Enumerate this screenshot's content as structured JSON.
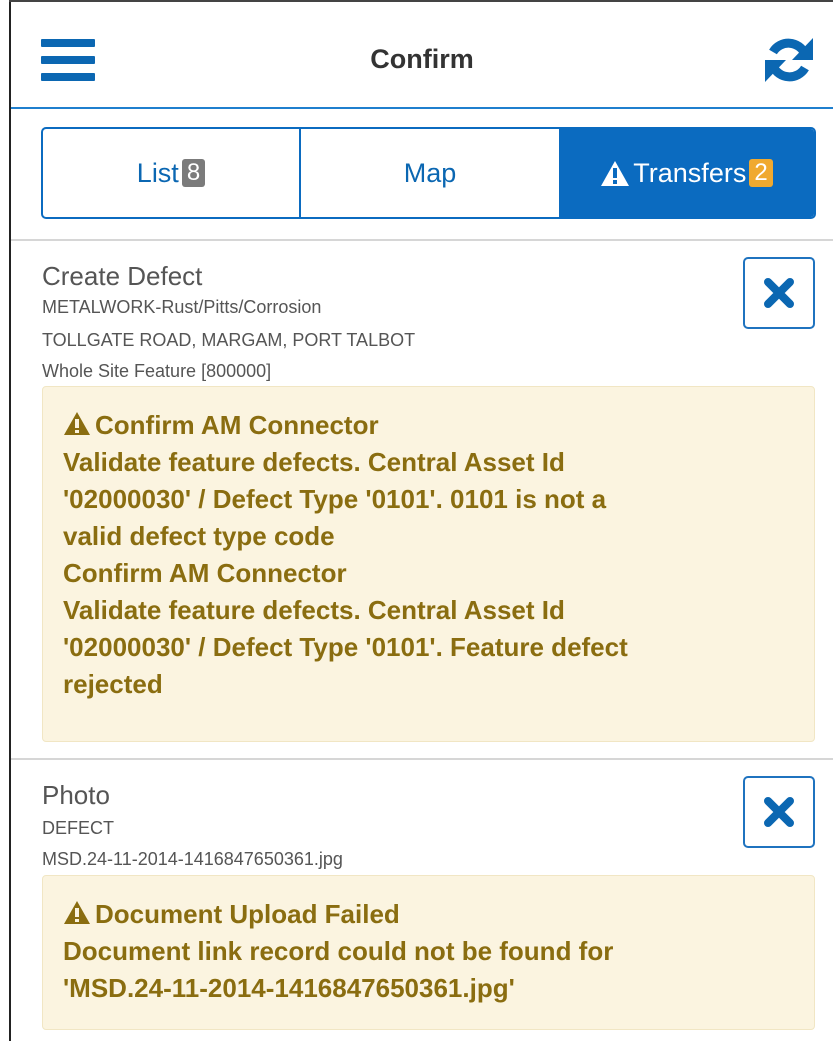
{
  "header": {
    "title": "Confirm",
    "menu_icon": "hamburger-menu-icon",
    "refresh_icon": "refresh-icon"
  },
  "tabs": [
    {
      "label": "List",
      "badge": "8"
    },
    {
      "label": "Map"
    },
    {
      "label": "Transfers",
      "badge": "2",
      "icon": "warning-icon",
      "active": true
    }
  ],
  "items": [
    {
      "title": "Create Defect",
      "lines": [
        "METALWORK-Rust/Pitts/Corrosion",
        "TOLLGATE ROAD, MARGAM, PORT TALBOT",
        "Whole Site Feature [800000]"
      ],
      "alert": [
        "Confirm AM Connector",
        "Validate feature defects. Central Asset Id",
        "'02000030' / Defect Type '0101'. 0101 is not a",
        "valid defect type code",
        "Confirm AM Connector",
        "Validate feature defects. Central Asset Id",
        "'02000030' / Defect Type '0101'. Feature defect",
        "rejected"
      ]
    },
    {
      "title": "Photo",
      "lines": [
        "DEFECT",
        "MSD.24-11-2014-1416847650361.jpg"
      ],
      "alert": [
        "Document Upload Failed",
        "Document link record could not be found for",
        "'MSD.24-11-2014-1416847650361.jpg'"
      ]
    }
  ],
  "colors": {
    "primary": "#0b6bc0",
    "badge_grey": "#7b7b7b",
    "badge_orange": "#f0a92f",
    "alert_bg": "#fbf4e0",
    "alert_text": "#8a6d10"
  }
}
